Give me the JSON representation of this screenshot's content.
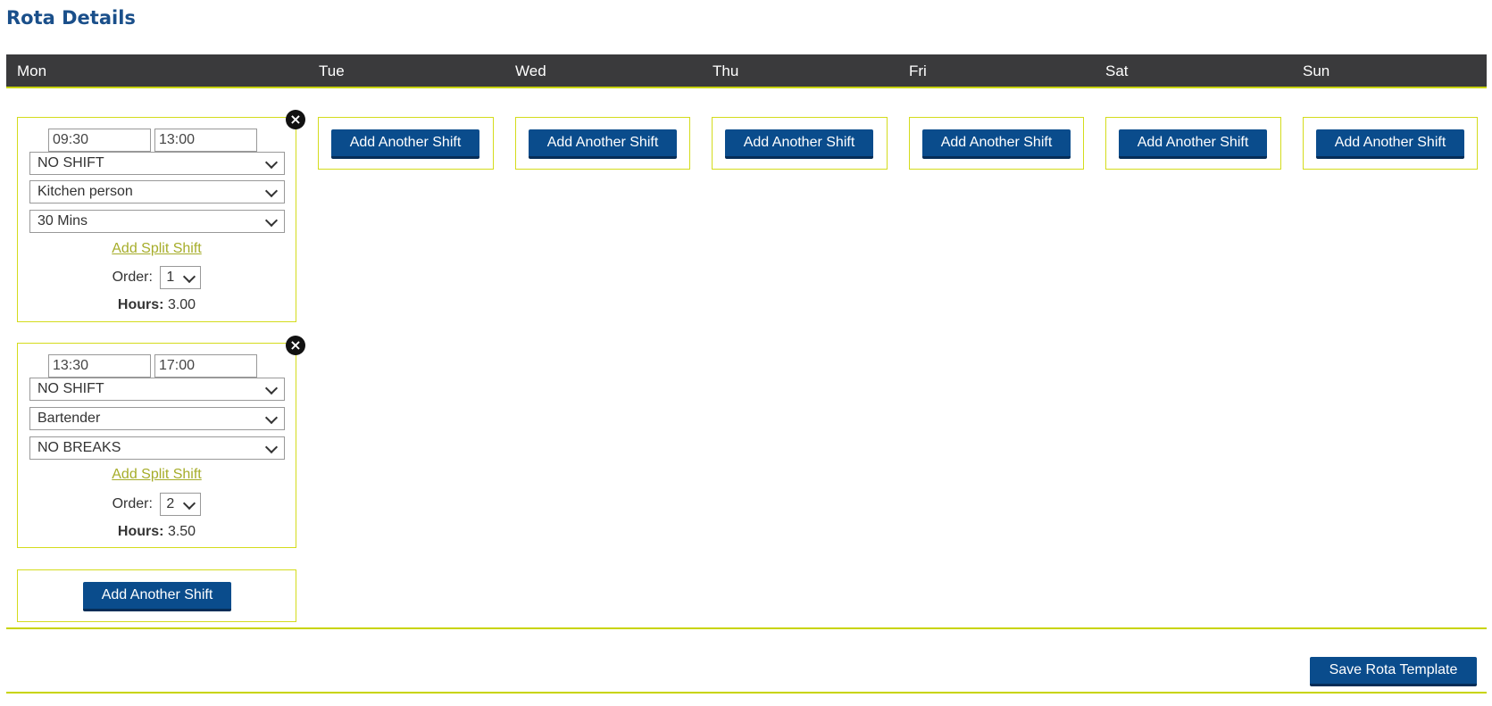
{
  "page": {
    "title": "Rota Details"
  },
  "days": [
    "Mon",
    "Tue",
    "Wed",
    "Thu",
    "Fri",
    "Sat",
    "Sun"
  ],
  "shifts": [
    {
      "start": "09:30",
      "end": "13:00",
      "shift_type": "NO SHIFT",
      "role": "Kitchen person",
      "break": "30 Mins",
      "split_label": "Add Split Shift",
      "order_label": "Order:",
      "order_value": "1",
      "hours_label": "Hours:",
      "hours_value": "3.00",
      "close_symbol": "×"
    },
    {
      "start": "13:30",
      "end": "17:00",
      "shift_type": "NO SHIFT",
      "role": "Bartender",
      "break": "NO BREAKS",
      "split_label": "Add Split Shift",
      "order_label": "Order:",
      "order_value": "2",
      "hours_label": "Hours:",
      "hours_value": "3.50",
      "close_symbol": "×"
    }
  ],
  "actions": {
    "add_shift_label": "Add Another Shift",
    "save_label": "Save Rota Template"
  },
  "colors": {
    "accent": "#0a4c8c",
    "header_bg": "#3a3a3c",
    "border_yellow": "#d4dc1c",
    "link": "#a6ad2a"
  }
}
